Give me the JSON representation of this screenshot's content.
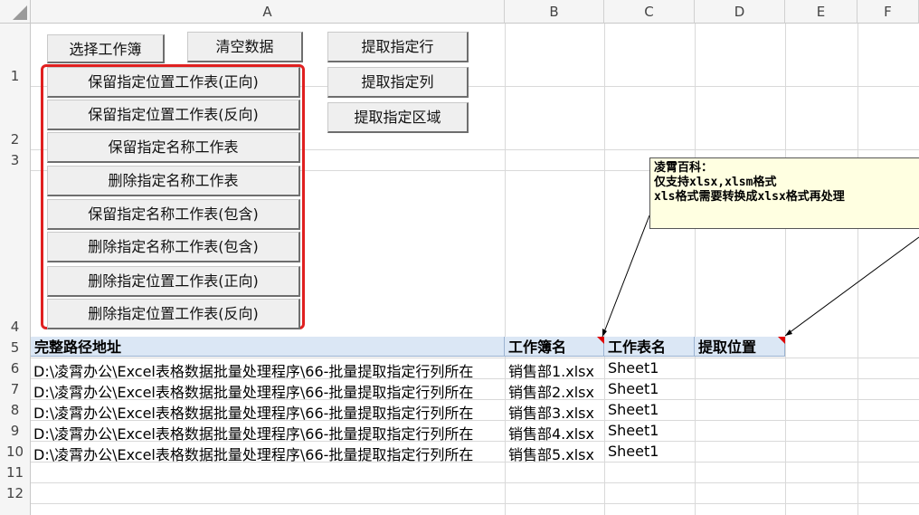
{
  "columns": [
    "A",
    "B",
    "C",
    "D",
    "E",
    "F"
  ],
  "rows": [
    "1",
    "2",
    "3",
    "4",
    "5",
    "6",
    "7",
    "8",
    "9",
    "10",
    "11",
    "12"
  ],
  "buttons": {
    "select_workbook": "选择工作簿",
    "clear_data": "清空数据",
    "extract_rows": "提取指定行",
    "extract_cols": "提取指定列",
    "extract_range": "提取指定区域",
    "keep_pos_fwd": "保留指定位置工作表(正向)",
    "keep_pos_rev": "保留指定位置工作表(反向)",
    "keep_name": "保留指定名称工作表",
    "delete_name": "删除指定名称工作表",
    "keep_name_contains": "保留指定名称工作表(包含)",
    "delete_name_contains": "删除指定名称工作表(包含)",
    "delete_pos_fwd": "删除指定位置工作表(正向)",
    "delete_pos_rev": "删除指定位置工作表(反向)"
  },
  "comment": {
    "line1": "凌霄百科：",
    "line2": "仅支持xlsx,xlsm格式",
    "line3": "xls格式需要转换成xlsx格式再处理"
  },
  "table": {
    "headers": [
      "完整路径地址",
      "工作簿名",
      "工作表名",
      "提取位置"
    ],
    "rows": [
      {
        "path": "D:\\凌霄办公\\Excel表格数据批量处理程序\\66-批量提取指定行列所在",
        "workbook": "销售部1.xlsx",
        "sheet": "Sheet1"
      },
      {
        "path": "D:\\凌霄办公\\Excel表格数据批量处理程序\\66-批量提取指定行列所在",
        "workbook": "销售部2.xlsx",
        "sheet": "Sheet1"
      },
      {
        "path": "D:\\凌霄办公\\Excel表格数据批量处理程序\\66-批量提取指定行列所在",
        "workbook": "销售部3.xlsx",
        "sheet": "Sheet1"
      },
      {
        "path": "D:\\凌霄办公\\Excel表格数据批量处理程序\\66-批量提取指定行列所在",
        "workbook": "销售部4.xlsx",
        "sheet": "Sheet1"
      },
      {
        "path": "D:\\凌霄办公\\Excel表格数据批量处理程序\\66-批量提取指定行列所在",
        "workbook": "销售部5.xlsx",
        "sheet": "Sheet1"
      }
    ]
  },
  "colors": {
    "selection_box": "#e02020",
    "header_fill": "#dbe7f5",
    "comment_fill": "#ffffe1"
  }
}
